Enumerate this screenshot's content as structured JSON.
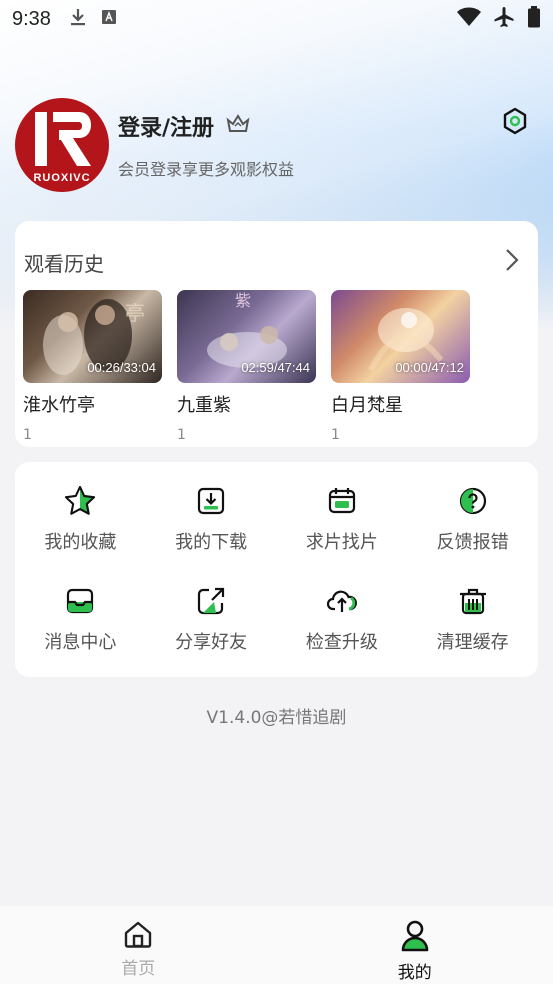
{
  "status_bar": {
    "time": "9:38",
    "icons": [
      "download-icon",
      "keyboard-icon",
      "wifi-icon",
      "airplane-icon",
      "battery-icon"
    ]
  },
  "profile": {
    "avatar_text": "RUOXIVC",
    "title": "登录/注册",
    "subtitle": "会员登录享更多观影权益"
  },
  "history": {
    "title": "观看历史",
    "items": [
      {
        "title": "淮水竹亭",
        "duration": "00:26/33:04",
        "episode": "1"
      },
      {
        "title": "九重紫",
        "duration": "02:59/47:44",
        "episode": "1"
      },
      {
        "title": "白月梵星",
        "duration": "00:00/47:12",
        "episode": "1"
      }
    ]
  },
  "menu": {
    "items": [
      {
        "label": "我的收藏",
        "icon": "star-icon"
      },
      {
        "label": "我的下载",
        "icon": "download-box-icon"
      },
      {
        "label": "求片找片",
        "icon": "calendar-icon"
      },
      {
        "label": "反馈报错",
        "icon": "question-icon"
      },
      {
        "label": "消息中心",
        "icon": "inbox-icon"
      },
      {
        "label": "分享好友",
        "icon": "share-icon"
      },
      {
        "label": "检查升级",
        "icon": "cloud-upload-icon"
      },
      {
        "label": "清理缓存",
        "icon": "trash-icon"
      }
    ]
  },
  "version": "V1.4.0@若惜追剧",
  "bottom_nav": {
    "home_label": "首页",
    "mine_label": "我的"
  },
  "colors": {
    "accent_green": "#2fbf4f",
    "avatar_red": "#b3151a"
  }
}
